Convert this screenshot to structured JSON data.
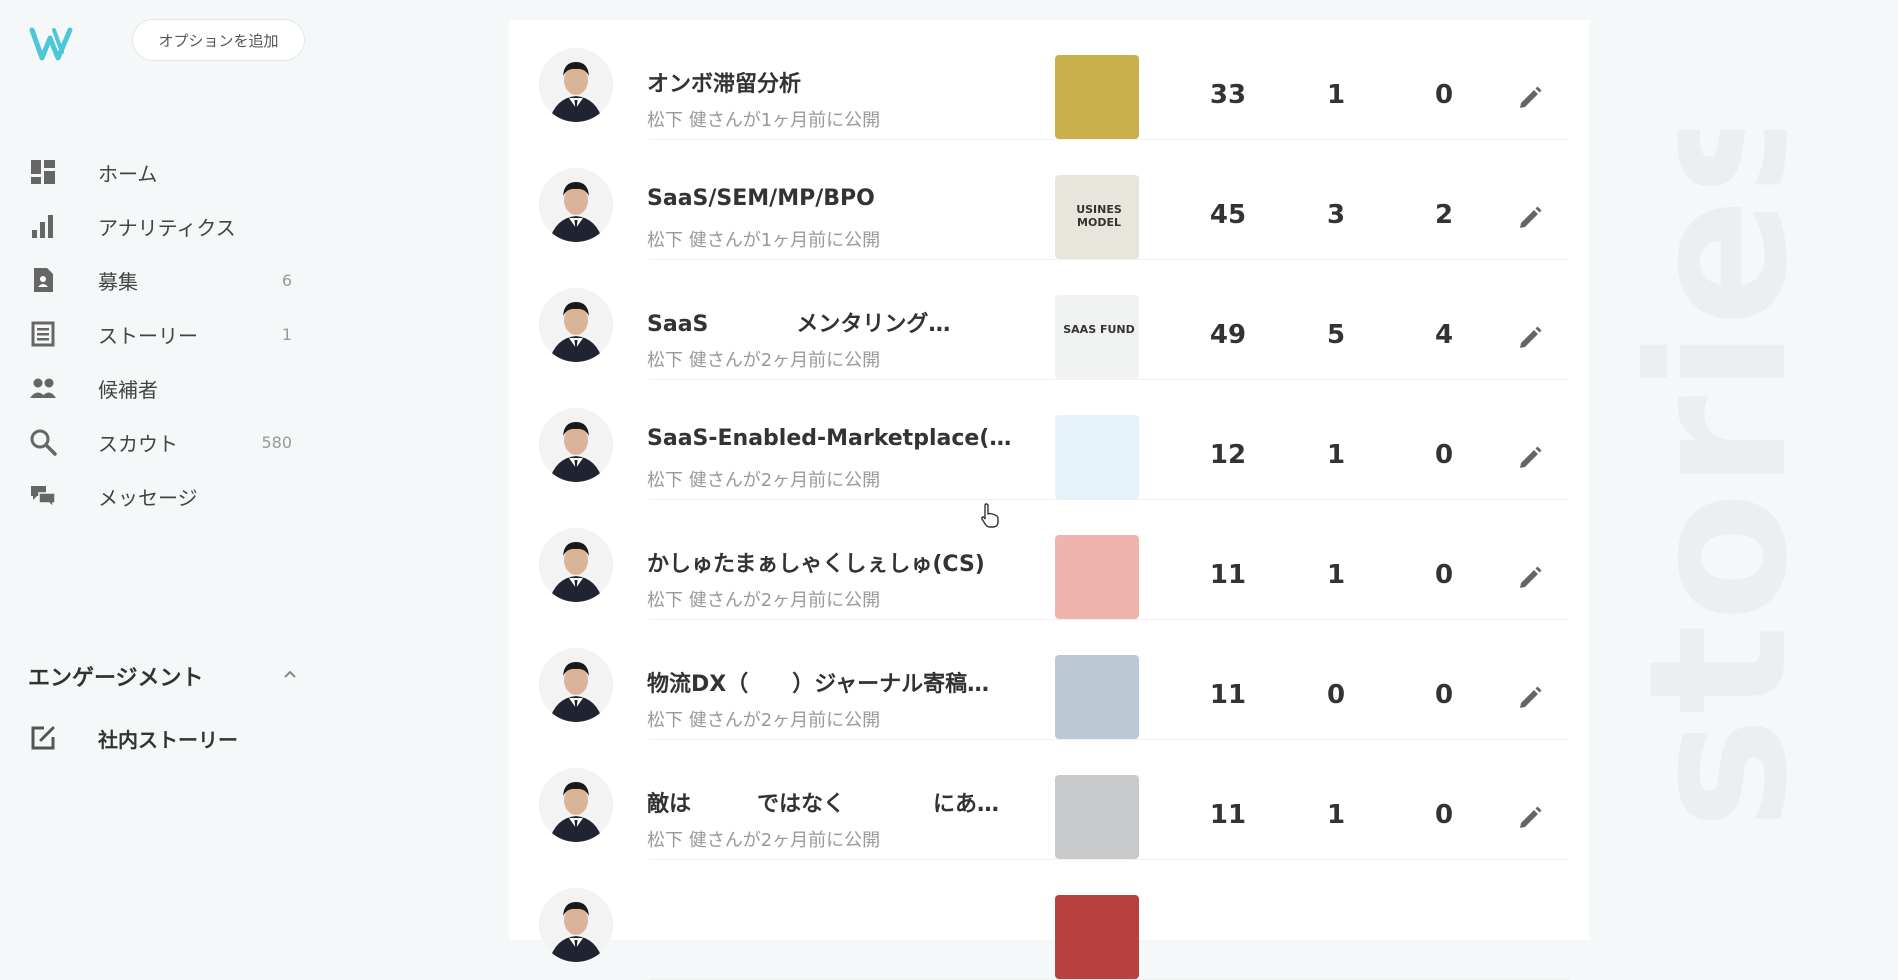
{
  "sidebar": {
    "add_option_label": "オプションを追加",
    "items": [
      {
        "label": "ホーム",
        "count": "",
        "icon": "dashboard-icon"
      },
      {
        "label": "アナリティクス",
        "count": "",
        "icon": "bar-chart-icon"
      },
      {
        "label": "募集",
        "count": "6",
        "icon": "document-icon"
      },
      {
        "label": "ストーリー",
        "count": "1",
        "icon": "article-icon"
      },
      {
        "label": "候補者",
        "count": "",
        "icon": "people-icon"
      },
      {
        "label": "スカウト",
        "count": "580",
        "icon": "search-icon"
      },
      {
        "label": "メッセージ",
        "count": "",
        "icon": "chat-icon"
      }
    ],
    "engagement": {
      "label": "エンゲージメント",
      "items": [
        {
          "label": "社内ストーリー",
          "icon": "edit-square-icon"
        }
      ]
    }
  },
  "watermark": "stories",
  "stories": [
    {
      "title": "オンボ滞留分析",
      "sub": "松下 健さんが1ヶ月前に公開",
      "v1": "33",
      "v2": "1",
      "v3": "0",
      "thumb": "#c9b04a"
    },
    {
      "title": "SaaS/SEM/MP/BPO",
      "sub": "松下 健さんが1ヶ月前に公開",
      "v1": "45",
      "v2": "3",
      "v3": "2",
      "thumb": "#e8e6dc",
      "thumb_text": "USINES MODEL"
    },
    {
      "title": "SaaS　　　　メンタリング…",
      "sub": "松下 健さんが2ヶ月前に公開",
      "v1": "49",
      "v2": "5",
      "v3": "4",
      "thumb": "#f0f2f2",
      "thumb_text": "SAAS FUND"
    },
    {
      "title": "SaaS-Enabled-Marketplace(…",
      "sub": "松下 健さんが2ヶ月前に公開",
      "v1": "12",
      "v2": "1",
      "v3": "0",
      "thumb": "#e5f2f8"
    },
    {
      "title": "かしゅたまぁしゃくしぇしゅ(CS)",
      "sub": "松下 健さんが2ヶ月前に公開",
      "v1": "11",
      "v2": "1",
      "v3": "0",
      "thumb": "#f0b4ae"
    },
    {
      "title": "物流DX（　　）ジャーナル寄稿…",
      "sub": "松下 健さんが2ヶ月前に公開",
      "v1": "11",
      "v2": "0",
      "v3": "0",
      "thumb": "#bcc8d2"
    },
    {
      "title": "敵は　　　ではなく　　　　にあ…",
      "sub": "松下 健さんが2ヶ月前に公開",
      "v1": "11",
      "v2": "1",
      "v3": "0",
      "thumb": "#c8cacc"
    },
    {
      "title": "",
      "sub": "",
      "v1": "",
      "v2": "",
      "v3": "",
      "thumb": "#b84040"
    }
  ]
}
